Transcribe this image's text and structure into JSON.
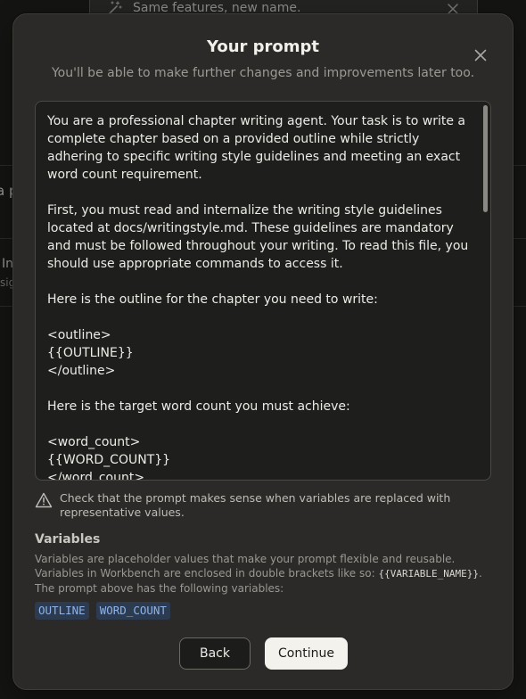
{
  "background": {
    "toast_text": "Same features, new name.",
    "fragment_1": "a p",
    "fragment_2": "In",
    "fragment_3": "sig"
  },
  "modal": {
    "title": "Your prompt",
    "subtitle": "You'll be able to make further changes and improvements later too.",
    "prompt_text": "You are a professional chapter writing agent. Your task is to write a complete chapter based on a provided outline while strictly adhering to specific writing style guidelines and meeting an exact word count requirement.\n\nFirst, you must read and internalize the writing style guidelines located at docs/writingstyle.md. These guidelines are mandatory and must be followed throughout your writing. To read this file, you should use appropriate commands to access it.\n\nHere is the outline for the chapter you need to write:\n\n<outline>\n{{OUTLINE}}\n</outline>\n\nHere is the target word count you must achieve:\n\n<word_count>\n{{WORD_COUNT}}\n</word_count>",
    "warning_text": "Check that the prompt makes sense when variables are replaced with representative values.",
    "variables_heading": "Variables",
    "variables_desc_before": "Variables are placeholder values that make your prompt flexible and reusable. Variables in Workbench are enclosed in double brackets like so: ",
    "variables_desc_code": "{{VARIABLE_NAME}}",
    "variables_desc_after": ". The prompt above has the following variables:",
    "variables": [
      "OUTLINE",
      "WORD_COUNT"
    ],
    "back_label": "Back",
    "continue_label": "Continue"
  },
  "colors": {
    "backdrop": "#141413",
    "modal_bg": "#2b2a28",
    "textarea_bg": "#1e1e1c",
    "chip_bg": "#2d3b50",
    "chip_text": "#8fb3e8",
    "continue_bg": "#f4f2ec"
  },
  "icons": {
    "toast": "magic-wand-icon",
    "toast_close": "close-icon",
    "modal_close": "close-icon",
    "warning": "warning-triangle-icon"
  }
}
